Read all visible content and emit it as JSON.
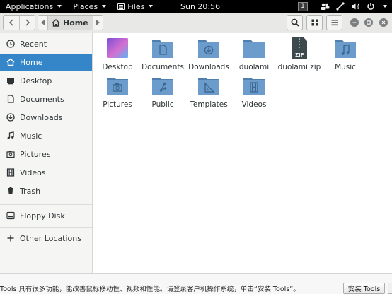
{
  "topbar": {
    "applications": "Applications",
    "places": "Places",
    "files": "Files",
    "clock": "Sun 20:56",
    "workspace": "1"
  },
  "header": {
    "location": "Home"
  },
  "sidebar": {
    "items": [
      {
        "label": "Recent",
        "icon": "clock-icon"
      },
      {
        "label": "Home",
        "icon": "home-icon",
        "active": true
      },
      {
        "label": "Desktop",
        "icon": "desktop-icon"
      },
      {
        "label": "Documents",
        "icon": "document-icon"
      },
      {
        "label": "Downloads",
        "icon": "download-icon"
      },
      {
        "label": "Music",
        "icon": "music-note-icon"
      },
      {
        "label": "Pictures",
        "icon": "camera-icon"
      },
      {
        "label": "Videos",
        "icon": "film-icon"
      },
      {
        "label": "Trash",
        "icon": "trash-icon"
      },
      {
        "label": "Floppy Disk",
        "icon": "drive-icon"
      },
      {
        "label": "Other Locations",
        "icon": "plus-icon"
      }
    ]
  },
  "files": [
    {
      "label": "Desktop",
      "icon": "desktop-folder-icon"
    },
    {
      "label": "Documents",
      "icon": "documents-folder-icon"
    },
    {
      "label": "Downloads",
      "icon": "downloads-folder-icon"
    },
    {
      "label": "duolami",
      "icon": "folder-icon"
    },
    {
      "label": "duolami.zip",
      "icon": "zip-archive-icon",
      "badge": "ZIP"
    },
    {
      "label": "Music",
      "icon": "music-folder-icon"
    },
    {
      "label": "Pictures",
      "icon": "pictures-folder-icon"
    },
    {
      "label": "Public",
      "icon": "public-folder-icon"
    },
    {
      "label": "Templates",
      "icon": "templates-folder-icon"
    },
    {
      "label": "Videos",
      "icon": "videos-folder-icon"
    }
  ],
  "bottombar": {
    "message": "Tools 具有很多功能，能改善鼠标移动性、视频和性能。请登录客户机操作系统，单击“安装 Tools”。",
    "install_button": "安装 Tools"
  },
  "colors": {
    "accent": "#3486c9",
    "folder": "#5c8fbe",
    "topbar": "#000000"
  }
}
